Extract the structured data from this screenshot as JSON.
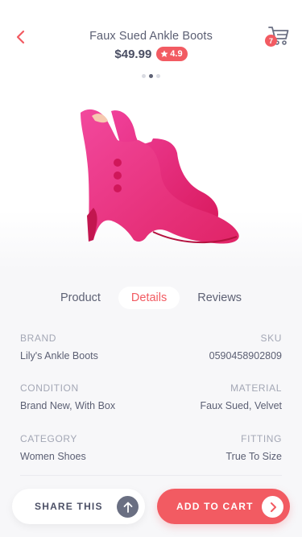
{
  "header": {
    "title": "Faux Sued Ankle Boots",
    "price": "$49.99",
    "rating": "4.9",
    "cart_count": "7"
  },
  "gallery": {
    "slide_count": 3,
    "active_slide": 2
  },
  "product_image": {
    "description_icon": "pink-ankle-boot-image"
  },
  "tabs": [
    {
      "label": "Product",
      "active": false
    },
    {
      "label": "Details",
      "active": true
    },
    {
      "label": "Reviews",
      "active": false
    }
  ],
  "details": [
    {
      "label": "BRAND",
      "value": "Lily's Ankle Boots"
    },
    {
      "label": "SKU",
      "value": "0590458902809"
    },
    {
      "label": "CONDITION",
      "value": "Brand New, With Box"
    },
    {
      "label": "MATERIAL",
      "value": "Faux Sued, Velvet"
    },
    {
      "label": "CATEGORY",
      "value": "Women Shoes"
    },
    {
      "label": "FITTING",
      "value": "True To Size"
    }
  ],
  "actions": {
    "share_label": "SHARE THIS",
    "add_to_cart_label": "ADD TO CART"
  },
  "colors": {
    "accent": "#f25b62",
    "text": "#4a4f63",
    "muted": "#a3a7b5",
    "background": "#f7f7f9",
    "product_pink": "#e8246f"
  }
}
